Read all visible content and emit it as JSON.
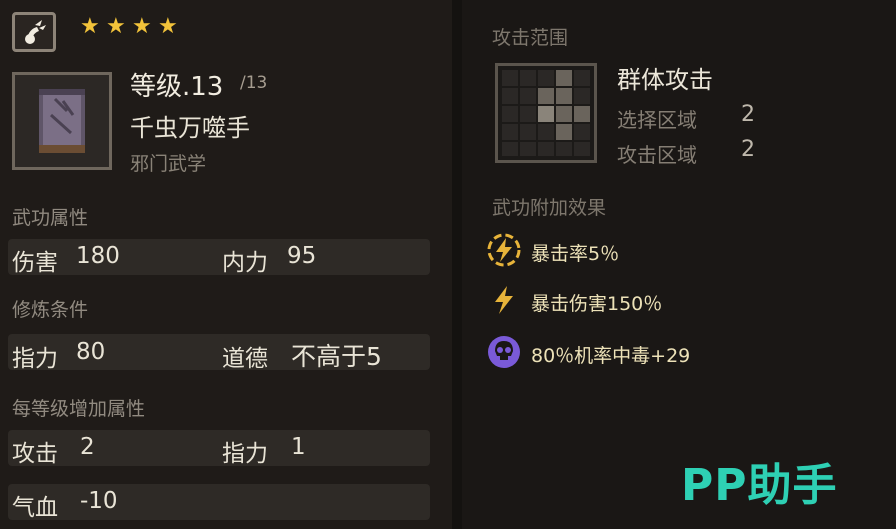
{
  "header": {
    "stars": 4
  },
  "skill": {
    "level_label": "等级.13",
    "level_max": "/13",
    "name": "千虫万噬手",
    "school": "邪门武学"
  },
  "attributes": {
    "title": "武功属性",
    "rows": [
      {
        "label1": "伤害",
        "value1": "180",
        "label2": "内力",
        "value2": "95"
      }
    ]
  },
  "requirements": {
    "title": "修炼条件",
    "label1": "指力",
    "value1": "80",
    "label2": "道德",
    "value2": "不高于5"
  },
  "per_level": {
    "title": "每等级增加属性",
    "rows": [
      {
        "label1": "攻击",
        "value1": "2",
        "label2": "指力",
        "value2": "1"
      },
      {
        "label1": "气血",
        "value1": "-10",
        "label2": "",
        "value2": ""
      }
    ]
  },
  "range": {
    "title": "攻击范围",
    "type": "群体攻击",
    "select_label": "选择区域",
    "select_value": "2",
    "attack_label": "攻击区域",
    "attack_value": "2"
  },
  "effects": {
    "title": "武功附加效果",
    "items": [
      {
        "icon": "lightning-circle-icon",
        "text": "暴击率5％",
        "color": "#e8b43a"
      },
      {
        "icon": "lightning-icon",
        "text": "暴击伤害150％",
        "color": "#e8b43a"
      },
      {
        "icon": "skull-icon",
        "text": "80％机率中毒+29",
        "color": "#7a5ad8"
      }
    ]
  },
  "watermark": "PP助手"
}
